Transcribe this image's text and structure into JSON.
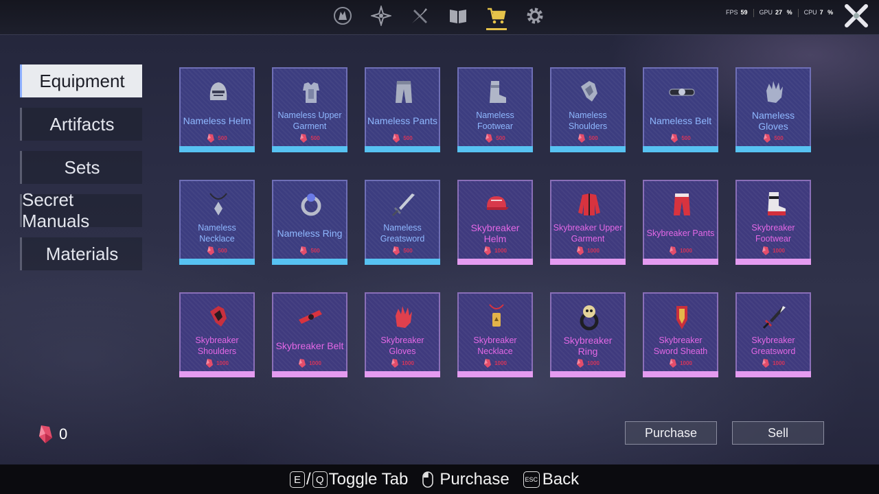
{
  "topbar": {
    "icons": [
      "character-icon",
      "compass-icon",
      "weapon-icon",
      "book-icon",
      "shop-cart-icon",
      "gear-icon"
    ],
    "active_icon": "shop-cart-icon",
    "stats": {
      "fps_label": "FPS",
      "fps_value": "59",
      "gpu_label": "GPU",
      "gpu_value": "27",
      "cpu_label": "CPU",
      "cpu_value": "7"
    }
  },
  "tabs": [
    {
      "label": "Equipment",
      "active": true
    },
    {
      "label": "Artifacts",
      "active": false
    },
    {
      "label": "Sets",
      "active": false
    },
    {
      "label": "Secret Manuals",
      "active": false
    },
    {
      "label": "Materials",
      "active": false
    }
  ],
  "items": [
    {
      "name": "Nameless Helm",
      "icon": "helm-icon",
      "tier": "blue",
      "price": "500"
    },
    {
      "name": "Nameless Upper Garment",
      "icon": "armor-icon",
      "tier": "blue",
      "price": "500"
    },
    {
      "name": "Nameless Pants",
      "icon": "pants-icon",
      "tier": "blue",
      "price": "500"
    },
    {
      "name": "Nameless Footwear",
      "icon": "boots-icon",
      "tier": "blue",
      "price": "500"
    },
    {
      "name": "Nameless Shoulders",
      "icon": "shoulders-icon",
      "tier": "blue",
      "price": "500"
    },
    {
      "name": "Nameless Belt",
      "icon": "belt-icon",
      "tier": "blue",
      "price": "500"
    },
    {
      "name": "Nameless Gloves",
      "icon": "gloves-icon",
      "tier": "blue",
      "price": "500"
    },
    {
      "name": "Nameless Necklace",
      "icon": "necklace-icon",
      "tier": "blue",
      "price": "500"
    },
    {
      "name": "Nameless Ring",
      "icon": "ring-icon",
      "tier": "blue",
      "price": "500"
    },
    {
      "name": "Nameless Greatsword",
      "icon": "sword-icon",
      "tier": "blue",
      "price": "500"
    },
    {
      "name": "Skybreaker Helm",
      "icon": "cap-icon",
      "tier": "pink",
      "price": "1000"
    },
    {
      "name": "Skybreaker Upper Garment",
      "icon": "jacket-icon",
      "tier": "pink",
      "price": "1000"
    },
    {
      "name": "Skybreaker Pants",
      "icon": "pants-icon",
      "tier": "pink",
      "price": "1000"
    },
    {
      "name": "Skybreaker Footwear",
      "icon": "sneaker-icon",
      "tier": "pink",
      "price": "1000"
    },
    {
      "name": "Skybreaker Shoulders",
      "icon": "shoulders-icon",
      "tier": "pink",
      "price": "1000"
    },
    {
      "name": "Skybreaker Belt",
      "icon": "belt-icon",
      "tier": "pink",
      "price": "1000"
    },
    {
      "name": "Skybreaker Gloves",
      "icon": "gloves-icon",
      "tier": "pink",
      "price": "1000"
    },
    {
      "name": "Skybreaker Necklace",
      "icon": "tag-necklace-icon",
      "tier": "pink",
      "price": "1000"
    },
    {
      "name": "Skybreaker Ring",
      "icon": "skull-ring-icon",
      "tier": "pink",
      "price": "1000"
    },
    {
      "name": "Skybreaker Sword Sheath",
      "icon": "sheath-icon",
      "tier": "pink",
      "price": "1000"
    },
    {
      "name": "Skybreaker Greatsword",
      "icon": "sword-icon",
      "tier": "pink",
      "price": "1000"
    }
  ],
  "currency": {
    "icon": "gem-icon",
    "value": "0"
  },
  "buttons": {
    "purchase": "Purchase",
    "sell": "Sell"
  },
  "footer": {
    "key_e": "E",
    "slash": "/",
    "key_q": "Q",
    "toggle_label": "Toggle Tab",
    "purchase_label": "Purchase",
    "key_esc": "ESC",
    "back_label": "Back"
  },
  "colors": {
    "blue_tier": "#57c2f2",
    "pink_tier": "#e49bf0",
    "price": "#d6345a",
    "active_underline": "#e6c34a"
  }
}
